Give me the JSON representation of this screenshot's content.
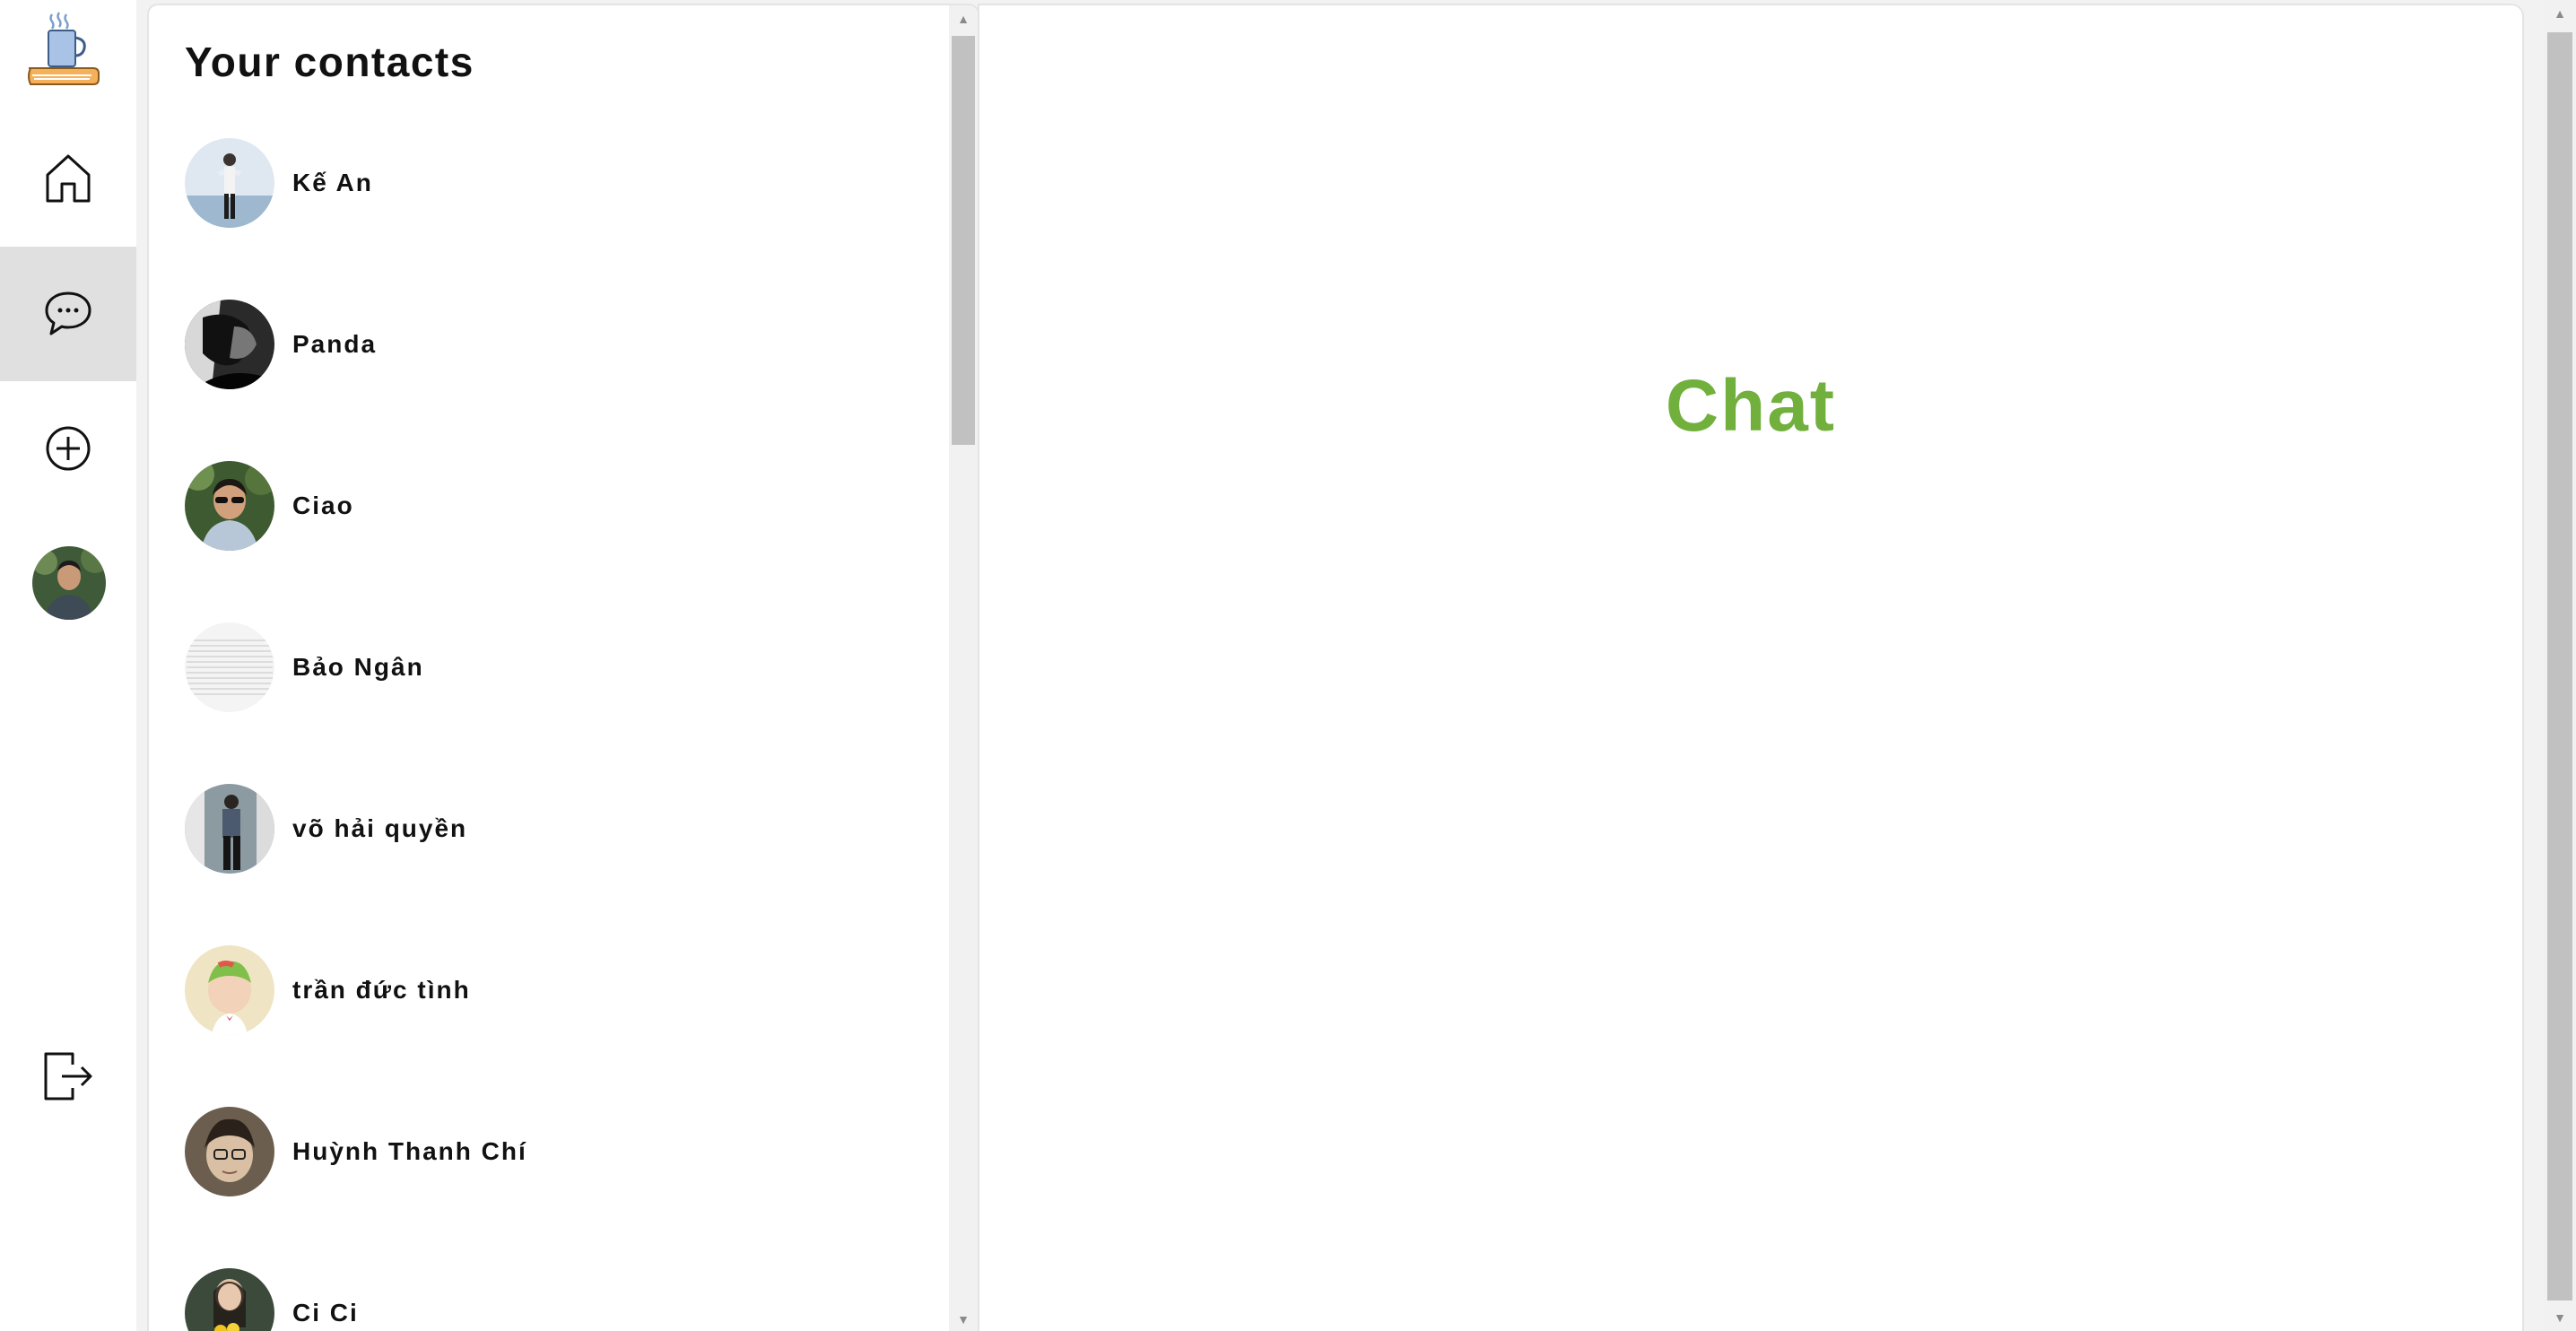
{
  "nav": {
    "items": [
      {
        "name": "home",
        "icon": "home-icon",
        "active": false
      },
      {
        "name": "chat",
        "icon": "chat-bubble-icon",
        "active": true
      },
      {
        "name": "add",
        "icon": "plus-circle-icon",
        "active": false
      },
      {
        "name": "profile",
        "icon": "user-avatar",
        "active": false
      },
      {
        "name": "logout",
        "icon": "logout-icon",
        "active": false
      }
    ]
  },
  "contacts": {
    "title": "Your contacts",
    "items": [
      {
        "name": "Kế An"
      },
      {
        "name": "Panda"
      },
      {
        "name": "Ciao"
      },
      {
        "name": "Bảo Ngân"
      },
      {
        "name": "võ hải quyền"
      },
      {
        "name": "trần đức tình"
      },
      {
        "name": "Huỳnh Thanh Chí"
      },
      {
        "name": "Ci Ci"
      }
    ]
  },
  "chat": {
    "placeholder": "Chat"
  },
  "colors": {
    "accent": "#72b03e",
    "active_nav_bg": "#e0e0e0",
    "text": "#111111"
  }
}
